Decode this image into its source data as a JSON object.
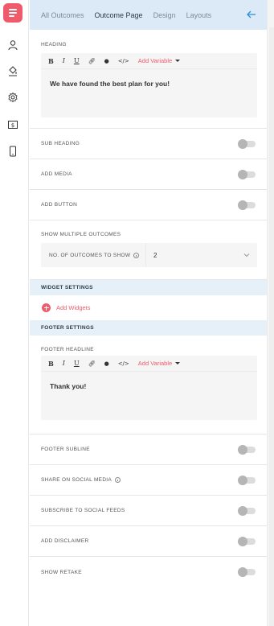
{
  "rail": {
    "items": [
      {
        "icon": "outcome-icon",
        "active": true
      },
      {
        "icon": "user-icon",
        "active": false
      },
      {
        "icon": "paint-bucket-icon",
        "active": false
      },
      {
        "icon": "gear-icon",
        "active": false
      },
      {
        "icon": "dollar-icon",
        "active": false
      },
      {
        "icon": "mobile-icon",
        "active": false
      }
    ],
    "accent": "#ef5b6b"
  },
  "tabs": [
    {
      "label": "All Outcomes",
      "active": false
    },
    {
      "label": "Outcome Page",
      "active": true
    },
    {
      "label": "Design",
      "active": false
    },
    {
      "label": "Layouts",
      "active": false
    }
  ],
  "heading": {
    "label": "HEADING",
    "toolbar": {
      "bold": "B",
      "italic": "I",
      "underline": "U",
      "add_variable": "Add Variable"
    },
    "content": "We have found the best plan for you!"
  },
  "toggles": [
    {
      "label": "SUB HEADING",
      "on": false
    },
    {
      "label": "ADD MEDIA",
      "on": false
    },
    {
      "label": "ADD BUTTON",
      "on": false
    }
  ],
  "multi_outcomes": {
    "label": "SHOW MULTIPLE OUTCOMES",
    "field_label": "NO. OF OUTCOMES TO SHOW",
    "value": "2"
  },
  "widget_settings": {
    "label": "WIDGET SETTINGS",
    "add_label": "Add Widgets"
  },
  "footer_settings": {
    "label": "FOOTER SETTINGS",
    "headline_label": "FOOTER HEADLINE",
    "toolbar": {
      "bold": "B",
      "italic": "I",
      "underline": "U",
      "add_variable": "Add Variable"
    },
    "content": "Thank you!"
  },
  "footer_toggles": [
    {
      "label": "FOOTER SUBLINE",
      "on": false,
      "info": false
    },
    {
      "label": "SHARE ON SOCIAL MEDIA",
      "on": false,
      "info": true
    },
    {
      "label": "SUBSCRIBE TO SOCIAL FEEDS",
      "on": false,
      "info": false
    },
    {
      "label": "ADD DISCLAIMER",
      "on": false,
      "info": false
    },
    {
      "label": "SHOW RETAKE",
      "on": false,
      "info": false
    }
  ],
  "colors": {
    "tab_bar": "#dbeaf6",
    "band": "#e6f0f8",
    "toggle_track": "#dcdcdc",
    "toggle_knob": "#b5b5b5"
  }
}
